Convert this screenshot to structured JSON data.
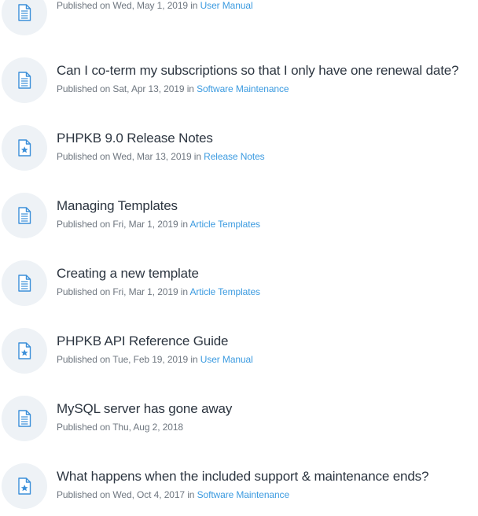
{
  "articles": [
    {
      "icon": "document-icon",
      "title": "",
      "meta_prefix": "Published on Wed, May 1, 2019",
      "in_label": " in ",
      "category": "User Manual"
    },
    {
      "icon": "document-icon",
      "title": "Can I co-term my subscriptions so that I only have one renewal date?",
      "meta_prefix": "Published on Sat, Apr 13, 2019",
      "in_label": " in ",
      "category": "Software Maintenance"
    },
    {
      "icon": "starred-document-icon",
      "title": "PHPKB 9.0 Release Notes",
      "meta_prefix": "Published on Wed, Mar 13, 2019",
      "in_label": " in ",
      "category": "Release Notes"
    },
    {
      "icon": "document-icon",
      "title": "Managing Templates",
      "meta_prefix": "Published on Fri, Mar 1, 2019",
      "in_label": " in ",
      "category": "Article Templates"
    },
    {
      "icon": "document-icon",
      "title": "Creating a new template",
      "meta_prefix": "Published on Fri, Mar 1, 2019",
      "in_label": " in ",
      "category": "Article Templates"
    },
    {
      "icon": "starred-document-icon",
      "title": "PHPKB API Reference Guide",
      "meta_prefix": "Published on Tue, Feb 19, 2019",
      "in_label": " in ",
      "category": "User Manual"
    },
    {
      "icon": "document-icon",
      "title": "MySQL server has gone away",
      "meta_prefix": "Published on Thu, Aug 2, 2018",
      "in_label": "",
      "category": ""
    },
    {
      "icon": "starred-document-icon",
      "title": "What happens when the included support & maintenance ends?",
      "meta_prefix": "Published on Wed, Oct 4, 2017",
      "in_label": " in ",
      "category": "Software Maintenance"
    }
  ],
  "colors": {
    "icon_blue": "#3b8fd9",
    "link_blue": "#3c9be0",
    "title_text": "#2c3540",
    "meta_text": "#6f7780",
    "badge_bg": "#eef2f6"
  }
}
